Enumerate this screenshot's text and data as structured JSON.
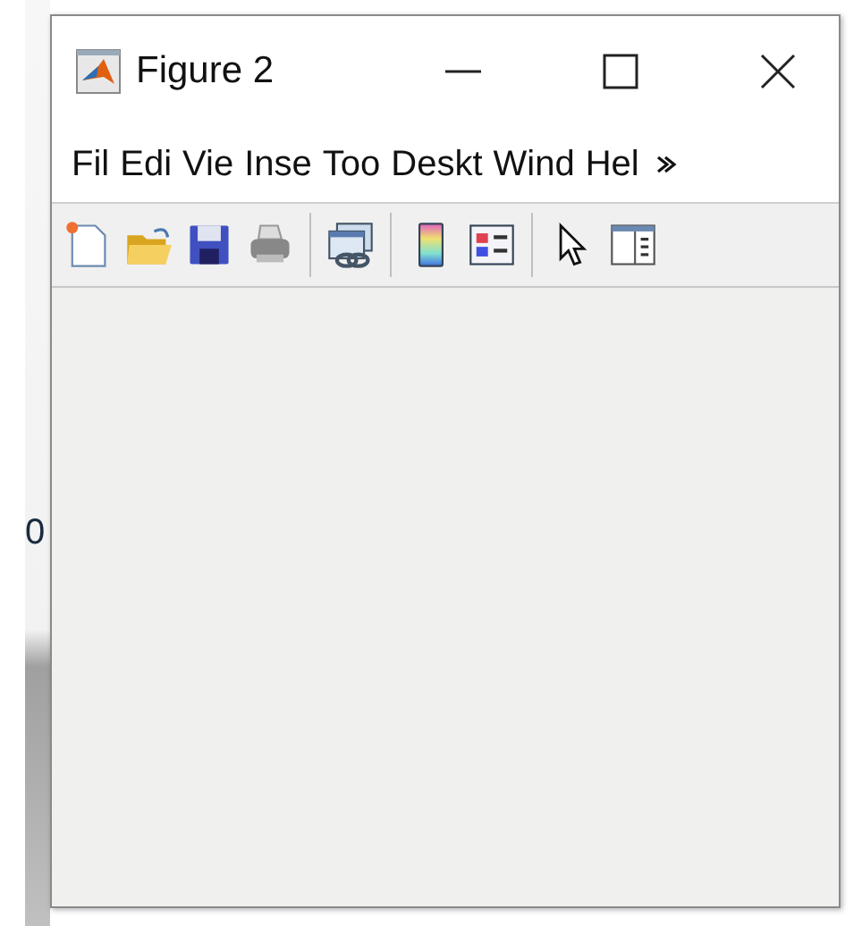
{
  "background": {
    "text": "0"
  },
  "window": {
    "title": "Figure 2"
  },
  "menu": [
    "Fil",
    "Edi",
    "Vie",
    "Inse",
    "Too",
    "Deskt",
    "Wind",
    "Hel"
  ]
}
